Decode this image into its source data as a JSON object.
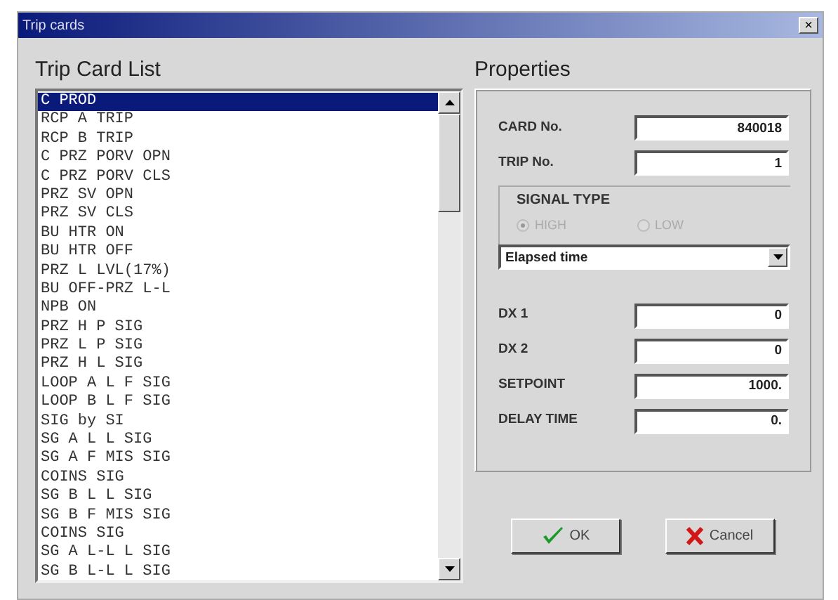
{
  "window": {
    "title": "Trip cards",
    "close": "×"
  },
  "list": {
    "heading": "Trip Card List",
    "items": [
      {
        "label": "C PROD",
        "selected": true
      },
      {
        "label": "RCP A TRIP",
        "selected": false
      },
      {
        "label": "RCP B TRIP",
        "selected": false
      },
      {
        "label": "C PRZ PORV OPN",
        "selected": false
      },
      {
        "label": "C PRZ PORV CLS",
        "selected": false
      },
      {
        "label": "PRZ SV OPN",
        "selected": false
      },
      {
        "label": "PRZ SV CLS",
        "selected": false
      },
      {
        "label": "BU HTR ON",
        "selected": false
      },
      {
        "label": "BU HTR OFF",
        "selected": false
      },
      {
        "label": "PRZ L LVL(17%)",
        "selected": false
      },
      {
        "label": "BU OFF-PRZ L-L",
        "selected": false
      },
      {
        "label": "NPB ON",
        "selected": false
      },
      {
        "label": "PRZ H P SIG",
        "selected": false
      },
      {
        "label": "PRZ L P SIG",
        "selected": false
      },
      {
        "label": "PRZ H L SIG",
        "selected": false
      },
      {
        "label": "LOOP A L F SIG",
        "selected": false
      },
      {
        "label": "LOOP B L F SIG",
        "selected": false
      },
      {
        "label": "SIG by SI",
        "selected": false
      },
      {
        "label": "SG A L L SIG",
        "selected": false
      },
      {
        "label": "SG A F MIS SIG",
        "selected": false
      },
      {
        "label": "COINS SIG",
        "selected": false
      },
      {
        "label": "SG B L L SIG",
        "selected": false
      },
      {
        "label": "SG B F MIS SIG",
        "selected": false
      },
      {
        "label": "COINS SIG",
        "selected": false
      },
      {
        "label": "SG A L-L L SIG",
        "selected": false
      },
      {
        "label": "SG B L-L L SIG",
        "selected": false
      }
    ]
  },
  "properties": {
    "heading": "Properties",
    "top_fields": [
      {
        "label": "CARD No.",
        "value": "840018"
      },
      {
        "label": "TRIP No.",
        "value": "1"
      }
    ],
    "signal_type": {
      "label": "SIGNAL TYPE",
      "options": [
        {
          "label": "HIGH",
          "selected": true,
          "disabled": true
        },
        {
          "label": "LOW",
          "selected": false,
          "disabled": true
        }
      ]
    },
    "dropdown": {
      "value": "Elapsed time"
    },
    "bottom_fields": [
      {
        "label": "DX 1",
        "value": "0"
      },
      {
        "label": "DX 2",
        "value": "0"
      },
      {
        "label": "SETPOINT",
        "value": "1000."
      },
      {
        "label": "DELAY TIME",
        "value": "0."
      }
    ]
  },
  "buttons": [
    {
      "kind": "ok",
      "label": "OK"
    },
    {
      "kind": "cancel",
      "label": "Cancel"
    }
  ]
}
